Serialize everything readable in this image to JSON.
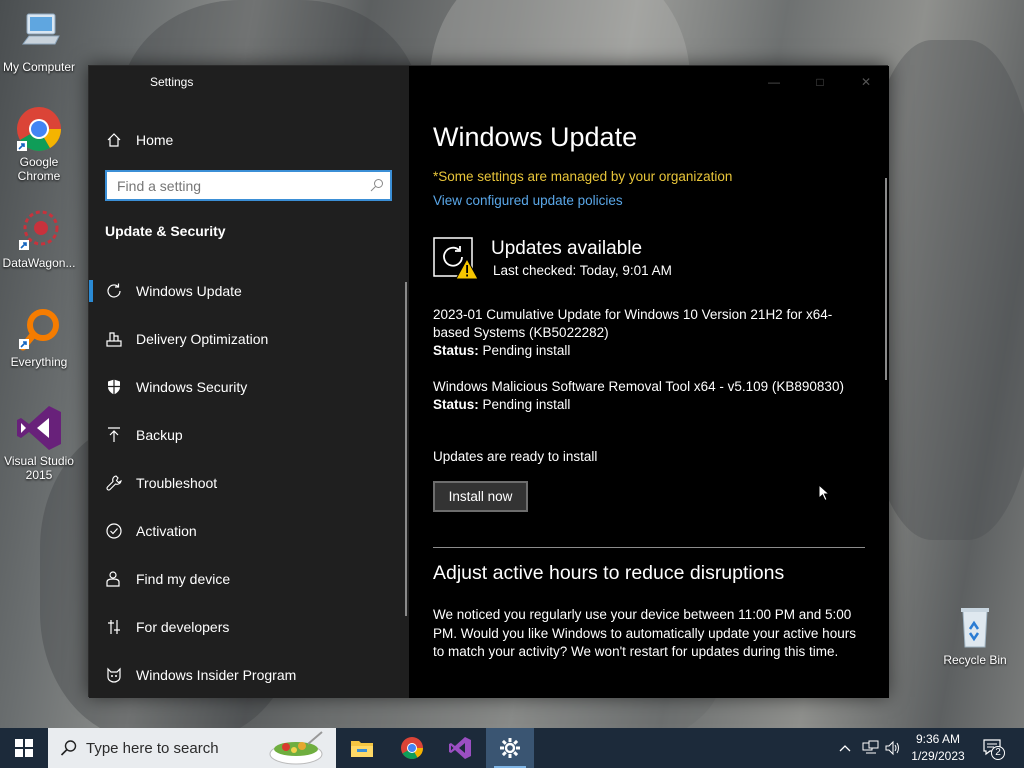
{
  "desktop": {
    "icons": [
      {
        "label": "My Computer"
      },
      {
        "label": "Google\nChrome"
      },
      {
        "label": "DataWagon..."
      },
      {
        "label": "Everything"
      },
      {
        "label": "Visual Studio\n2015"
      },
      {
        "label": "Recycle Bin"
      }
    ]
  },
  "window": {
    "title": "Settings",
    "controls": [
      "minimize",
      "maximize",
      "close"
    ]
  },
  "sidebar": {
    "home_label": "Home",
    "search_placeholder": "Find a setting",
    "section_title": "Update & Security",
    "items": [
      {
        "label": "Windows Update",
        "icon": "refresh-icon",
        "active": true
      },
      {
        "label": "Delivery Optimization",
        "icon": "delivery-optimization-icon"
      },
      {
        "label": "Windows Security",
        "icon": "shield-icon"
      },
      {
        "label": "Backup",
        "icon": "backup-icon"
      },
      {
        "label": "Troubleshoot",
        "icon": "wrench-icon"
      },
      {
        "label": "Activation",
        "icon": "checkmark-circle-icon"
      },
      {
        "label": "Find my device",
        "icon": "person-location-icon"
      },
      {
        "label": "For developers",
        "icon": "developer-tools-icon"
      },
      {
        "label": "Windows Insider Program",
        "icon": "insider-cat-icon"
      }
    ]
  },
  "main": {
    "title": "Windows Update",
    "managed_notice": "*Some settings are managed by your organization",
    "policy_link": "View configured update policies",
    "status_title": "Updates available",
    "last_checked": "Last checked: Today, 9:01 AM",
    "updates": [
      {
        "name": "2023-01 Cumulative Update for Windows 10 Version 21H2 for x64-based Systems (KB5022282)",
        "status_label": "Status:",
        "status": "Pending install"
      },
      {
        "name": "Windows Malicious Software Removal Tool x64 - v5.109 (KB890830)",
        "status_label": "Status:",
        "status": "Pending install"
      }
    ],
    "ready_text": "Updates are ready to install",
    "install_button": "Install now",
    "active_hours_title": "Adjust active hours to reduce disruptions",
    "active_hours_text": "We noticed you regularly use your device between 11:00 PM and 5:00 PM. Would you like Windows to automatically update your active hours to match your activity? We won't restart for updates during this time."
  },
  "taskbar": {
    "search_placeholder": "Type here to search",
    "apps": [
      "file-explorer-icon",
      "chrome-icon",
      "visual-studio-icon",
      "settings-gear-icon"
    ],
    "clock_time": "9:36 AM",
    "clock_date": "1/29/2023",
    "notification_count": "2"
  },
  "colors": {
    "accent": "#2a8ad4",
    "warning_text": "#e8c53a",
    "link": "#5aa7e8"
  }
}
